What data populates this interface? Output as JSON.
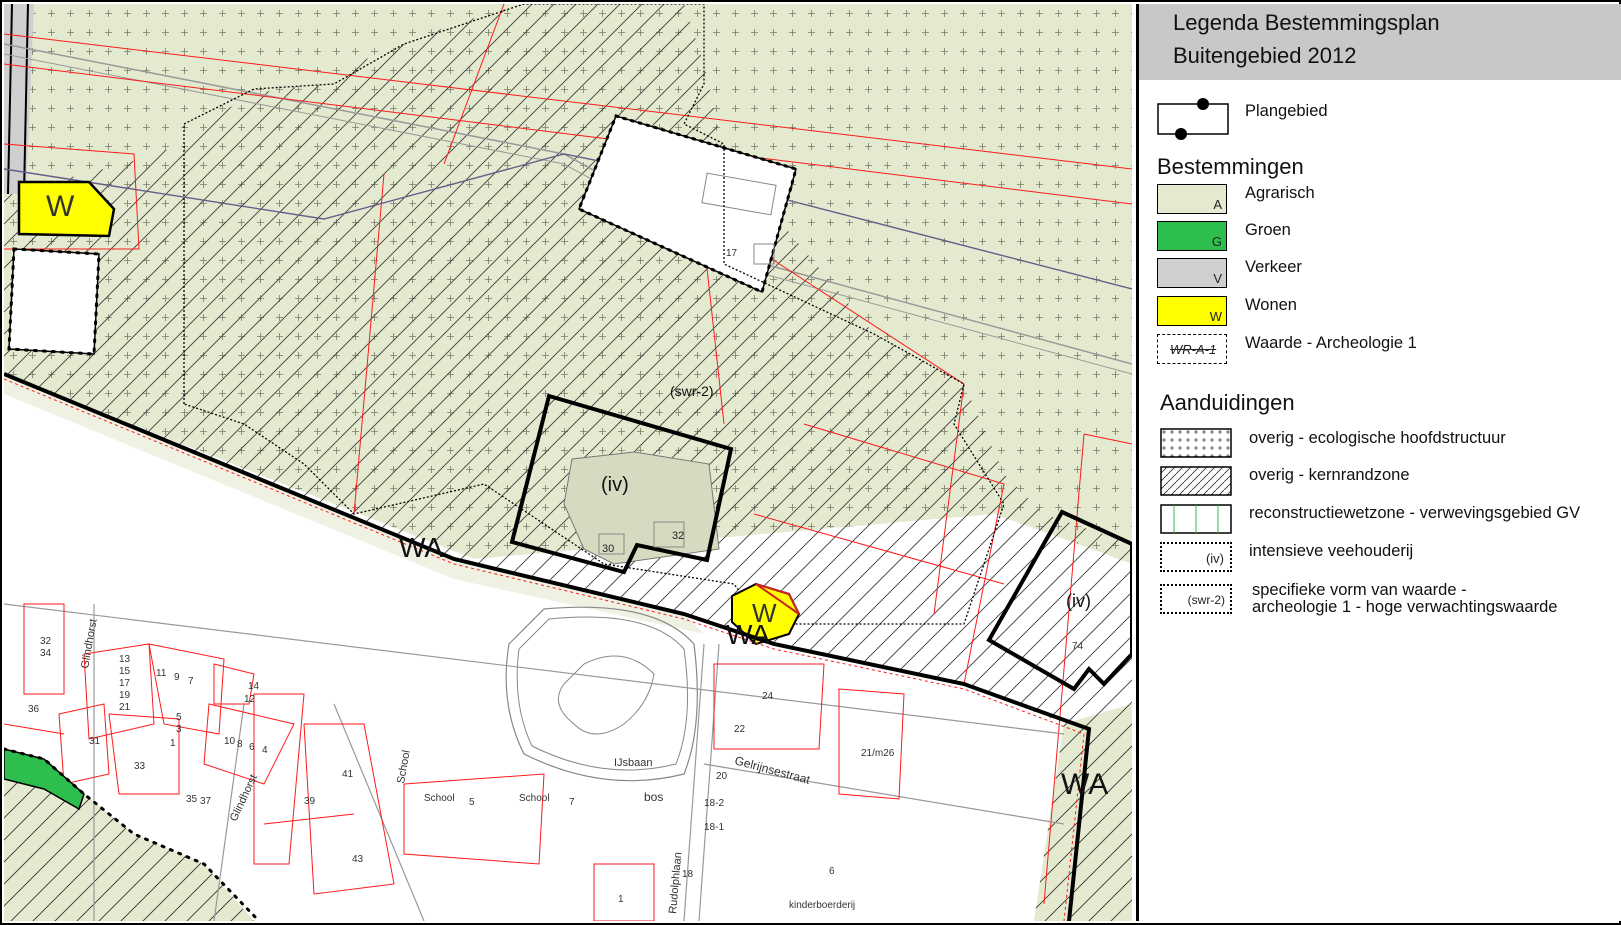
{
  "legend": {
    "title_line1": "Legenda Bestemmingsplan",
    "title_line2": "Buitengebied 2012",
    "plangebied": {
      "label": "Plangebied"
    },
    "bestemmingen": {
      "heading": "Bestemmingen",
      "items": [
        {
          "label": "Agrarisch",
          "code": "A",
          "color": "#e4ead0"
        },
        {
          "label": "Groen",
          "code": "G",
          "color": "#2dbe4d"
        },
        {
          "label": "Verkeer",
          "code": "V",
          "color": "#cfcfcf"
        },
        {
          "label": "Wonen",
          "code": "W",
          "color": "#ffff00"
        },
        {
          "label": "Waarde - Archeologie 1",
          "code": "WR-A-1",
          "color": "#ffffff"
        }
      ]
    },
    "aanduidingen": {
      "heading": "Aanduidingen",
      "items": [
        {
          "label": "overig - ecologische hoofdstructuur",
          "icon": "cross-hatch-icon"
        },
        {
          "label": "overig - kernrandzone",
          "icon": "diagonal-hatch-icon"
        },
        {
          "label": "reconstructiewetzone - verwevingsgebied GV",
          "icon": "vertical-lines-icon"
        },
        {
          "label": "intensieve veehouderij",
          "code": "(iv)",
          "icon": "dotted-box-icon"
        },
        {
          "label_line1": "specifieke vorm van waarde -",
          "label_line2": "archeologie 1 - hoge verwachtingswaarde",
          "code": "(swr-2)",
          "icon": "dotted-box-icon"
        }
      ]
    }
  },
  "map": {
    "colors": {
      "agrarisch": "#e4ead0",
      "wonen": "#ffff00",
      "groen": "#2dbe4d",
      "verkeer": "#cfcfcf",
      "parcel": "#ff1a1a"
    },
    "labels": {
      "w1": "W",
      "w2": "W",
      "wa1": "WA",
      "wa2": "WA",
      "wa3": "WA",
      "swr": "(swr-2)",
      "iv1": "(iv)",
      "iv2": "(iv)",
      "n17": "17",
      "n30": "30",
      "n32": "32",
      "n24": "24",
      "n22": "22",
      "n20": "20",
      "n18_2": "18-2",
      "n18_1": "18-1",
      "n18": "18",
      "n6": "6",
      "n1": "1",
      "n74": "74",
      "n21": "21/m26",
      "ijsbaan": "IJsbaan",
      "bos": "bos",
      "school1": "School",
      "school2": "School",
      "school3": "School",
      "n5": "5",
      "n7": "7",
      "n41": "41",
      "n39": "39",
      "n43": "43",
      "n31": "31",
      "n33": "33",
      "n36": "36",
      "n32b": "32",
      "n34": "34",
      "n35": "35",
      "n37": "37",
      "n13": "13",
      "n15": "15",
      "n17b": "17",
      "n19": "19",
      "n21b": "21",
      "n11": "11",
      "n9": "9",
      "n7b": "7",
      "n5b": "5",
      "n3": "3",
      "n1b": "1",
      "n14": "14",
      "n12": "12",
      "n10": "10",
      "n8": "8",
      "n6b": "6",
      "n4": "4",
      "glindhorst1": "Glindhorst",
      "glindhorst2": "Glindhorst",
      "gelrijnsestraat": "Gelrijnsestraat",
      "rudolphlaan": "Rudolphlaan",
      "kinderboerderij": "kinderboerderij"
    }
  }
}
